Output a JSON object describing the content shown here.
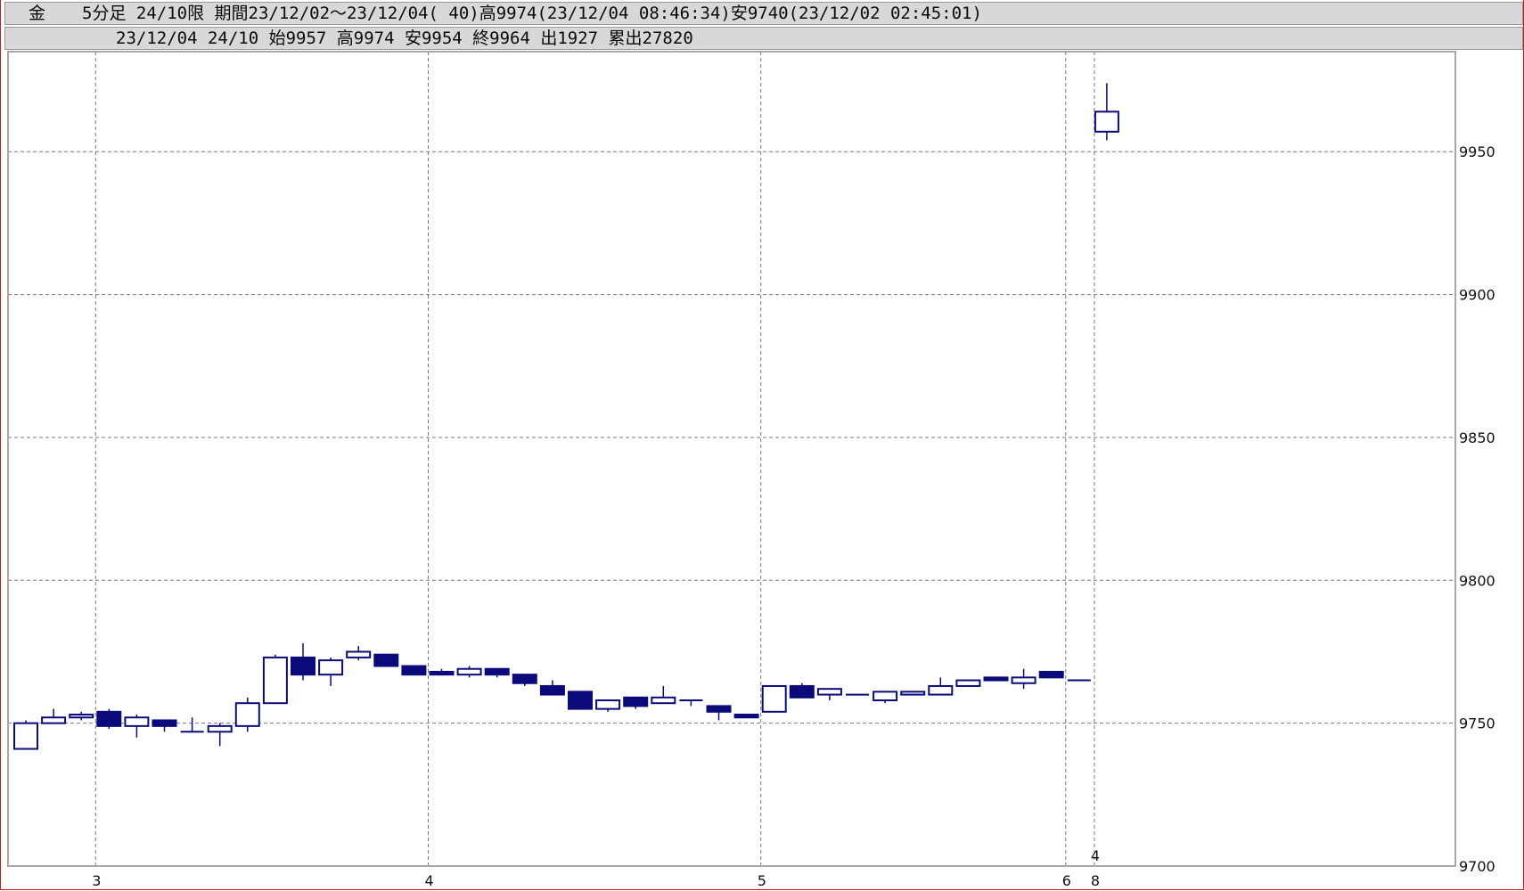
{
  "header": {
    "symbol": "金",
    "line1": "5分足 24/10限 期間23/12/02～23/12/04( 40)高9974(23/12/04 08:46:34)安9740(23/12/02 02:45:01)",
    "line2": "23/12/04 24/10 始9957 高9974 安9954 終9964 出1927 累出27820"
  },
  "chart_data": {
    "type": "candlestick",
    "up_color": "#ffffff",
    "down_color": "#0a0a7a",
    "line_color": "#0a0a7a",
    "ylim": [
      9700,
      9985
    ],
    "yticks": [
      9700,
      9750,
      9800,
      9850,
      9900,
      9950
    ],
    "grid": true,
    "xtick_labels": [
      {
        "label": "3",
        "index": 3
      },
      {
        "label": "4",
        "index": 15
      },
      {
        "label": "5",
        "index": 27
      },
      {
        "label": "6",
        "index": 38
      }
    ],
    "session_marker": {
      "top": "4",
      "bottom": "8",
      "index": 39
    },
    "candles": [
      {
        "o": 9741,
        "h": 9751,
        "l": 9741,
        "c": 9750
      },
      {
        "o": 9750,
        "h": 9755,
        "l": 9750,
        "c": 9752
      },
      {
        "o": 9752,
        "h": 9754,
        "l": 9751,
        "c": 9753
      },
      {
        "o": 9754,
        "h": 9755,
        "l": 9748,
        "c": 9749
      },
      {
        "o": 9749,
        "h": 9753,
        "l": 9745,
        "c": 9752
      },
      {
        "o": 9751,
        "h": 9751,
        "l": 9747,
        "c": 9749
      },
      {
        "o": 9747,
        "h": 9752,
        "l": 9747,
        "c": 9747
      },
      {
        "o": 9747,
        "h": 9750,
        "l": 9742,
        "c": 9749
      },
      {
        "o": 9749,
        "h": 9759,
        "l": 9747,
        "c": 9757
      },
      {
        "o": 9757,
        "h": 9774,
        "l": 9757,
        "c": 9773
      },
      {
        "o": 9773,
        "h": 9778,
        "l": 9765,
        "c": 9767
      },
      {
        "o": 9767,
        "h": 9773,
        "l": 9763,
        "c": 9772
      },
      {
        "o": 9773,
        "h": 9777,
        "l": 9772,
        "c": 9775
      },
      {
        "o": 9774,
        "h": 9774,
        "l": 9770,
        "c": 9770
      },
      {
        "o": 9770,
        "h": 9770,
        "l": 9767,
        "c": 9767
      },
      {
        "o": 9768,
        "h": 9769,
        "l": 9767,
        "c": 9767
      },
      {
        "o": 9767,
        "h": 9770,
        "l": 9766,
        "c": 9769
      },
      {
        "o": 9769,
        "h": 9769,
        "l": 9766,
        "c": 9767
      },
      {
        "o": 9767,
        "h": 9767,
        "l": 9763,
        "c": 9764
      },
      {
        "o": 9763,
        "h": 9765,
        "l": 9760,
        "c": 9760
      },
      {
        "o": 9761,
        "h": 9761,
        "l": 9755,
        "c": 9755
      },
      {
        "o": 9755,
        "h": 9758,
        "l": 9754,
        "c": 9758
      },
      {
        "o": 9759,
        "h": 9759,
        "l": 9755,
        "c": 9756
      },
      {
        "o": 9757,
        "h": 9763,
        "l": 9757,
        "c": 9759
      },
      {
        "o": 9758,
        "h": 9758,
        "l": 9756,
        "c": 9758
      },
      {
        "o": 9756,
        "h": 9756,
        "l": 9751,
        "c": 9754
      },
      {
        "o": 9753,
        "h": 9753,
        "l": 9752,
        "c": 9752
      },
      {
        "o": 9754,
        "h": 9763,
        "l": 9754,
        "c": 9763
      },
      {
        "o": 9763,
        "h": 9764,
        "l": 9759,
        "c": 9759
      },
      {
        "o": 9760,
        "h": 9762,
        "l": 9758,
        "c": 9762
      },
      {
        "o": 9760,
        "h": 9760,
        "l": 9760,
        "c": 9760
      },
      {
        "o": 9758,
        "h": 9761,
        "l": 9757,
        "c": 9761
      },
      {
        "o": 9760,
        "h": 9761,
        "l": 9760,
        "c": 9761
      },
      {
        "o": 9760,
        "h": 9766,
        "l": 9760,
        "c": 9763
      },
      {
        "o": 9763,
        "h": 9765,
        "l": 9763,
        "c": 9765
      },
      {
        "o": 9766,
        "h": 9766,
        "l": 9765,
        "c": 9765
      },
      {
        "o": 9764,
        "h": 9769,
        "l": 9762,
        "c": 9766
      },
      {
        "o": 9768,
        "h": 9768,
        "l": 9766,
        "c": 9766
      },
      {
        "o": 9765,
        "h": 9765,
        "l": 9765,
        "c": 9765
      },
      {
        "o": 9957,
        "h": 9974,
        "l": 9954,
        "c": 9964
      }
    ]
  }
}
